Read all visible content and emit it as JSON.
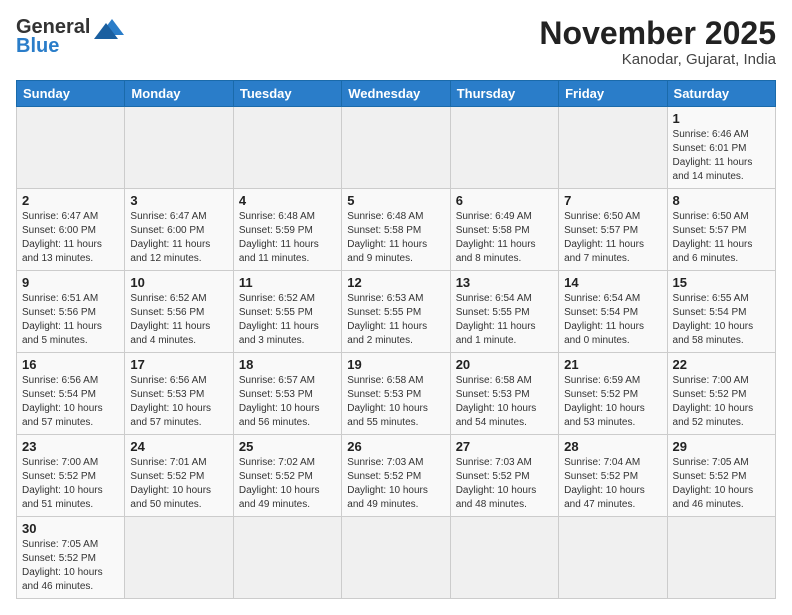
{
  "header": {
    "logo_general": "General",
    "logo_blue": "Blue",
    "month_title": "November 2025",
    "subtitle": "Kanodar, Gujarat, India"
  },
  "days_of_week": [
    "Sunday",
    "Monday",
    "Tuesday",
    "Wednesday",
    "Thursday",
    "Friday",
    "Saturday"
  ],
  "weeks": [
    [
      {
        "day": "",
        "info": ""
      },
      {
        "day": "",
        "info": ""
      },
      {
        "day": "",
        "info": ""
      },
      {
        "day": "",
        "info": ""
      },
      {
        "day": "",
        "info": ""
      },
      {
        "day": "",
        "info": ""
      },
      {
        "day": "1",
        "info": "Sunrise: 6:46 AM\nSunset: 6:01 PM\nDaylight: 11 hours\nand 14 minutes."
      }
    ],
    [
      {
        "day": "2",
        "info": "Sunrise: 6:47 AM\nSunset: 6:00 PM\nDaylight: 11 hours\nand 13 minutes."
      },
      {
        "day": "3",
        "info": "Sunrise: 6:47 AM\nSunset: 6:00 PM\nDaylight: 11 hours\nand 12 minutes."
      },
      {
        "day": "4",
        "info": "Sunrise: 6:48 AM\nSunset: 5:59 PM\nDaylight: 11 hours\nand 11 minutes."
      },
      {
        "day": "5",
        "info": "Sunrise: 6:48 AM\nSunset: 5:58 PM\nDaylight: 11 hours\nand 9 minutes."
      },
      {
        "day": "6",
        "info": "Sunrise: 6:49 AM\nSunset: 5:58 PM\nDaylight: 11 hours\nand 8 minutes."
      },
      {
        "day": "7",
        "info": "Sunrise: 6:50 AM\nSunset: 5:57 PM\nDaylight: 11 hours\nand 7 minutes."
      },
      {
        "day": "8",
        "info": "Sunrise: 6:50 AM\nSunset: 5:57 PM\nDaylight: 11 hours\nand 6 minutes."
      }
    ],
    [
      {
        "day": "9",
        "info": "Sunrise: 6:51 AM\nSunset: 5:56 PM\nDaylight: 11 hours\nand 5 minutes."
      },
      {
        "day": "10",
        "info": "Sunrise: 6:52 AM\nSunset: 5:56 PM\nDaylight: 11 hours\nand 4 minutes."
      },
      {
        "day": "11",
        "info": "Sunrise: 6:52 AM\nSunset: 5:55 PM\nDaylight: 11 hours\nand 3 minutes."
      },
      {
        "day": "12",
        "info": "Sunrise: 6:53 AM\nSunset: 5:55 PM\nDaylight: 11 hours\nand 2 minutes."
      },
      {
        "day": "13",
        "info": "Sunrise: 6:54 AM\nSunset: 5:55 PM\nDaylight: 11 hours\nand 1 minute."
      },
      {
        "day": "14",
        "info": "Sunrise: 6:54 AM\nSunset: 5:54 PM\nDaylight: 11 hours\nand 0 minutes."
      },
      {
        "day": "15",
        "info": "Sunrise: 6:55 AM\nSunset: 5:54 PM\nDaylight: 10 hours\nand 58 minutes."
      }
    ],
    [
      {
        "day": "16",
        "info": "Sunrise: 6:56 AM\nSunset: 5:54 PM\nDaylight: 10 hours\nand 57 minutes."
      },
      {
        "day": "17",
        "info": "Sunrise: 6:56 AM\nSunset: 5:53 PM\nDaylight: 10 hours\nand 57 minutes."
      },
      {
        "day": "18",
        "info": "Sunrise: 6:57 AM\nSunset: 5:53 PM\nDaylight: 10 hours\nand 56 minutes."
      },
      {
        "day": "19",
        "info": "Sunrise: 6:58 AM\nSunset: 5:53 PM\nDaylight: 10 hours\nand 55 minutes."
      },
      {
        "day": "20",
        "info": "Sunrise: 6:58 AM\nSunset: 5:53 PM\nDaylight: 10 hours\nand 54 minutes."
      },
      {
        "day": "21",
        "info": "Sunrise: 6:59 AM\nSunset: 5:52 PM\nDaylight: 10 hours\nand 53 minutes."
      },
      {
        "day": "22",
        "info": "Sunrise: 7:00 AM\nSunset: 5:52 PM\nDaylight: 10 hours\nand 52 minutes."
      }
    ],
    [
      {
        "day": "23",
        "info": "Sunrise: 7:00 AM\nSunset: 5:52 PM\nDaylight: 10 hours\nand 51 minutes."
      },
      {
        "day": "24",
        "info": "Sunrise: 7:01 AM\nSunset: 5:52 PM\nDaylight: 10 hours\nand 50 minutes."
      },
      {
        "day": "25",
        "info": "Sunrise: 7:02 AM\nSunset: 5:52 PM\nDaylight: 10 hours\nand 49 minutes."
      },
      {
        "day": "26",
        "info": "Sunrise: 7:03 AM\nSunset: 5:52 PM\nDaylight: 10 hours\nand 49 minutes."
      },
      {
        "day": "27",
        "info": "Sunrise: 7:03 AM\nSunset: 5:52 PM\nDaylight: 10 hours\nand 48 minutes."
      },
      {
        "day": "28",
        "info": "Sunrise: 7:04 AM\nSunset: 5:52 PM\nDaylight: 10 hours\nand 47 minutes."
      },
      {
        "day": "29",
        "info": "Sunrise: 7:05 AM\nSunset: 5:52 PM\nDaylight: 10 hours\nand 46 minutes."
      }
    ],
    [
      {
        "day": "30",
        "info": "Sunrise: 7:05 AM\nSunset: 5:52 PM\nDaylight: 10 hours\nand 46 minutes."
      },
      {
        "day": "",
        "info": ""
      },
      {
        "day": "",
        "info": ""
      },
      {
        "day": "",
        "info": ""
      },
      {
        "day": "",
        "info": ""
      },
      {
        "day": "",
        "info": ""
      },
      {
        "day": "",
        "info": ""
      }
    ]
  ]
}
